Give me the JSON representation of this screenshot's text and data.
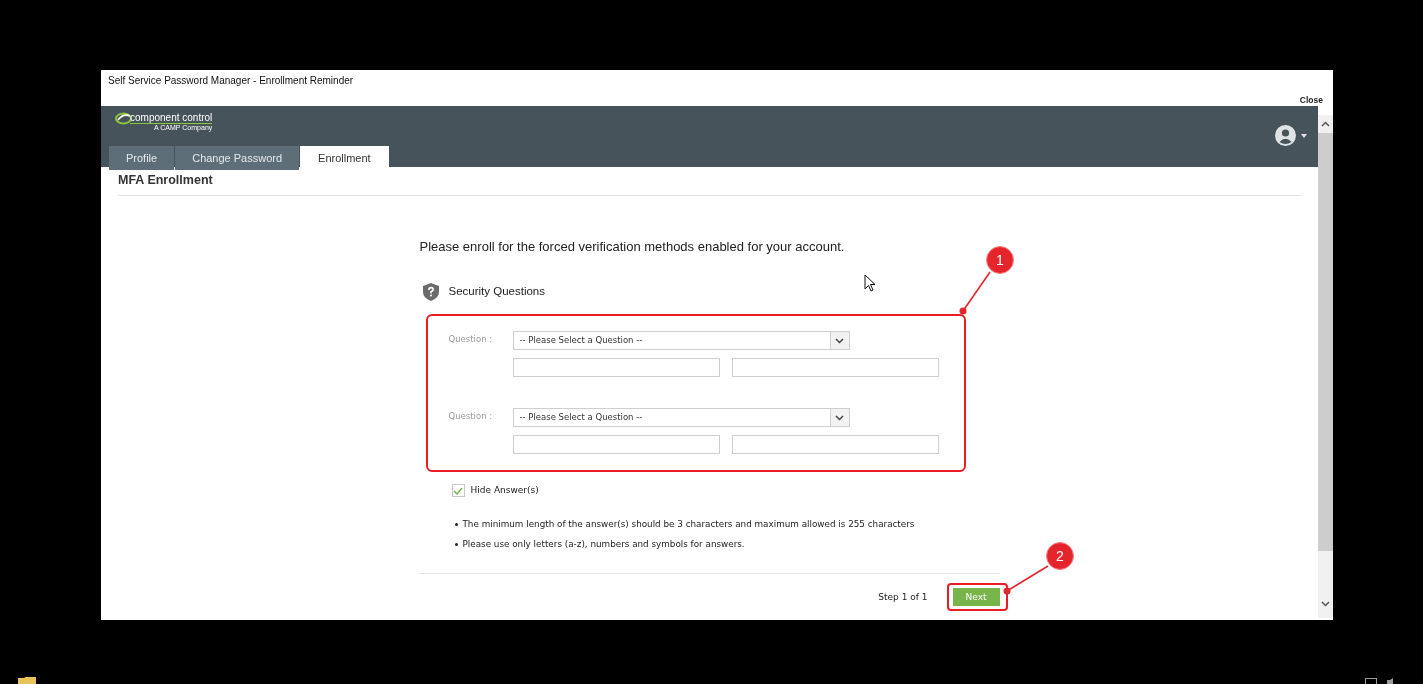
{
  "window": {
    "title": "Self Service Password Manager - Enrollment Reminder",
    "close": "Close"
  },
  "header": {
    "logo": {
      "name": "component control",
      "tagline": "A CAMP Company"
    },
    "tabs": [
      {
        "label": "Profile",
        "selected": false
      },
      {
        "label": "Change Password",
        "selected": false
      },
      {
        "label": "Enrollment",
        "selected": true
      }
    ]
  },
  "page_title": "MFA Enrollment",
  "intro": "Please enroll for the forced verification methods enabled for your account.",
  "security_questions": {
    "title": "Security Questions",
    "questions": [
      {
        "label": "Question :",
        "value": "-- Please Select a Question --"
      },
      {
        "label": "Question :",
        "value": "-- Please Select a Question --"
      }
    ]
  },
  "hide_answers": {
    "label": "Hide Answer(s)",
    "checked": true
  },
  "notes": [
    "The minimum length of the answer(s) should be 3 characters and maximum allowed is 255 characters",
    "Please use only letters (a-z), numbers and symbols for answers."
  ],
  "footer": {
    "step": "Step 1 of 1",
    "next": "Next"
  },
  "callouts": [
    {
      "number": "1"
    },
    {
      "number": "2"
    }
  ]
}
